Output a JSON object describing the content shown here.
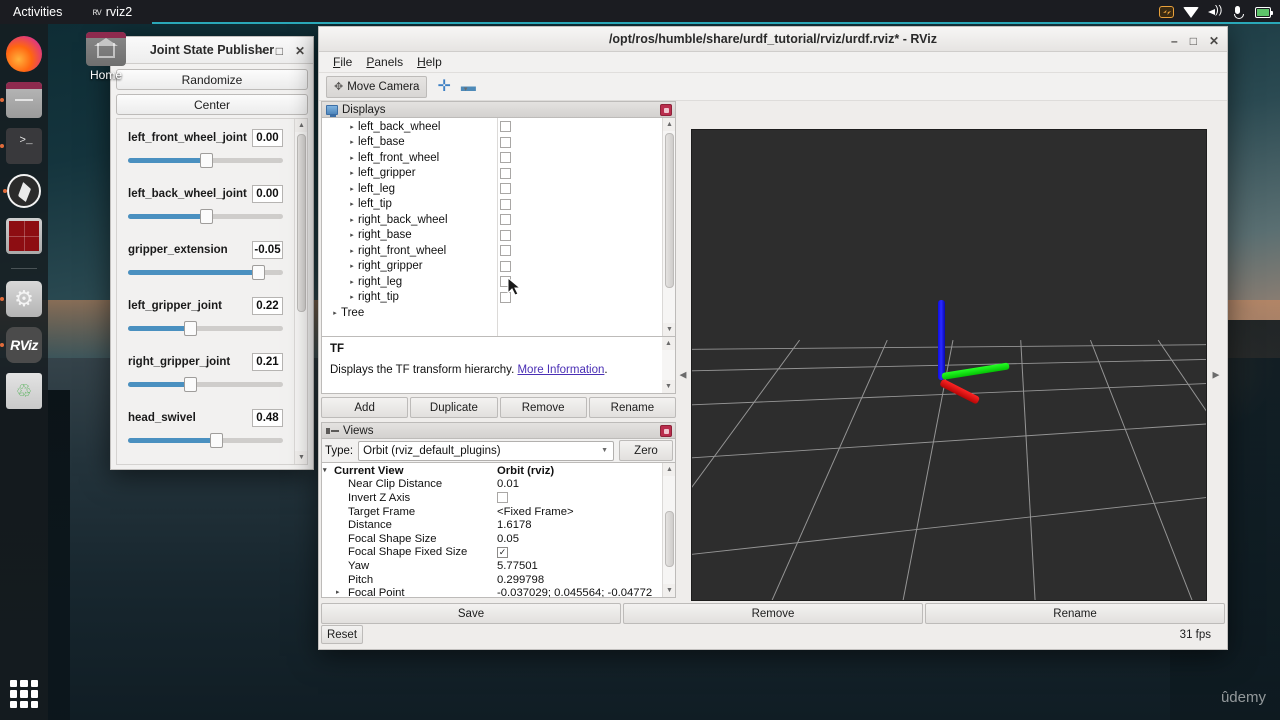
{
  "desktop": {
    "topbar": {
      "activities": "Activities",
      "app_name": "rviz2",
      "app_icon": "rviz-glyph-icon",
      "tray": [
        "screencast-icon",
        "wifi-icon",
        "volume-icon",
        "microphone-icon",
        "battery-icon"
      ]
    },
    "dock": [
      {
        "name": "firefox",
        "running": false
      },
      {
        "name": "files",
        "running": true
      },
      {
        "name": "terminal",
        "running": true
      },
      {
        "name": "obs-studio",
        "running": true
      },
      {
        "name": "red-app",
        "running": false
      },
      {
        "name": "settings",
        "running": true
      },
      {
        "name": "rviz",
        "running": true,
        "label": "RViz"
      },
      {
        "name": "trash",
        "running": false
      }
    ],
    "home_icon_label": "Home",
    "watermark": "ûdemy"
  },
  "joint_state_publisher": {
    "title": "Joint State Publisher",
    "window_buttons": [
      "minimize",
      "maximize",
      "close"
    ],
    "buttons": {
      "randomize": "Randomize",
      "center": "Center"
    },
    "sliders": [
      {
        "name": "left_front_wheel_joint",
        "value": "0.00",
        "percent": 50
      },
      {
        "name": "left_back_wheel_joint",
        "value": "0.00",
        "percent": 50
      },
      {
        "name": "gripper_extension",
        "value": "-0.05",
        "percent": 84
      },
      {
        "name": "left_gripper_joint",
        "value": "0.22",
        "percent": 40
      },
      {
        "name": "right_gripper_joint",
        "value": "0.21",
        "percent": 40
      },
      {
        "name": "head_swivel",
        "value": "0.48",
        "percent": 57
      }
    ]
  },
  "rviz": {
    "title": "/opt/ros/humble/share/urdf_tutorial/rviz/urdf.rviz* - RViz",
    "window_buttons": [
      "minimize",
      "maximize",
      "close"
    ],
    "menus": [
      {
        "label": "File",
        "mnemonic": "F"
      },
      {
        "label": "Panels",
        "mnemonic": "P"
      },
      {
        "label": "Help",
        "mnemonic": "H"
      }
    ],
    "toolbar": {
      "move_camera": "Move Camera",
      "move_camera_icon": "move-camera-icon",
      "add_tool_icon": "plus-icon",
      "remove_tool_icon": "minus-dropdown-icon"
    },
    "displays_panel": {
      "title": "Displays",
      "icon": "monitor-icon",
      "close_icon": "panel-close-icon",
      "tree": [
        {
          "label": "left_back_wheel",
          "level": 1,
          "checked": false
        },
        {
          "label": "left_base",
          "level": 1,
          "checked": false
        },
        {
          "label": "left_front_wheel",
          "level": 1,
          "checked": false
        },
        {
          "label": "left_gripper",
          "level": 1,
          "checked": false
        },
        {
          "label": "left_leg",
          "level": 1,
          "checked": false
        },
        {
          "label": "left_tip",
          "level": 1,
          "checked": false
        },
        {
          "label": "right_back_wheel",
          "level": 1,
          "checked": false
        },
        {
          "label": "right_base",
          "level": 1,
          "checked": false
        },
        {
          "label": "right_front_wheel",
          "level": 1,
          "checked": false
        },
        {
          "label": "right_gripper",
          "level": 1,
          "checked": false
        },
        {
          "label": "right_leg",
          "level": 1,
          "checked": false
        },
        {
          "label": "right_tip",
          "level": 1,
          "checked": false
        },
        {
          "label": "Tree",
          "level": 0,
          "checked": null
        }
      ],
      "description": {
        "title": "TF",
        "text": "Displays the TF transform hierarchy. ",
        "link": "More Information",
        "suffix": "."
      },
      "buttons": [
        "Add",
        "Duplicate",
        "Remove",
        "Rename"
      ]
    },
    "views_panel": {
      "title": "Views",
      "icon": "views-icon",
      "close_icon": "panel-close-icon",
      "type_label": "Type:",
      "type_value": "Orbit (rviz_default_plugins)",
      "zero_button": "Zero",
      "properties": [
        {
          "key": "Current View",
          "value": "Orbit (rviz)",
          "kind": "header"
        },
        {
          "key": "Near Clip Distance",
          "value": "0.01",
          "kind": "text"
        },
        {
          "key": "Invert Z Axis",
          "value": "",
          "kind": "checkbox",
          "checked": false
        },
        {
          "key": "Target Frame",
          "value": "<Fixed Frame>",
          "kind": "text"
        },
        {
          "key": "Distance",
          "value": "1.6178",
          "kind": "text"
        },
        {
          "key": "Focal Shape Size",
          "value": "0.05",
          "kind": "text"
        },
        {
          "key": "Focal Shape Fixed Size",
          "value": "",
          "kind": "checkbox",
          "checked": true
        },
        {
          "key": "Yaw",
          "value": "5.77501",
          "kind": "text"
        },
        {
          "key": "Pitch",
          "value": "0.299798",
          "kind": "text"
        },
        {
          "key": "Focal Point",
          "value": "-0.037029; 0.045564; -0.04772",
          "kind": "sub"
        }
      ],
      "buttons": [
        "Save",
        "Remove",
        "Rename"
      ]
    },
    "statusbar": {
      "reset": "Reset",
      "fps": "31 fps"
    },
    "viewport": {
      "background_color": "#2d2d2d",
      "grid_color": "#a8a8a8",
      "axes": [
        {
          "name": "z-axis",
          "color": "#2b2bff"
        },
        {
          "name": "y-axis",
          "color": "#22ee22"
        },
        {
          "name": "x-axis",
          "color": "#ee2020"
        }
      ]
    }
  }
}
